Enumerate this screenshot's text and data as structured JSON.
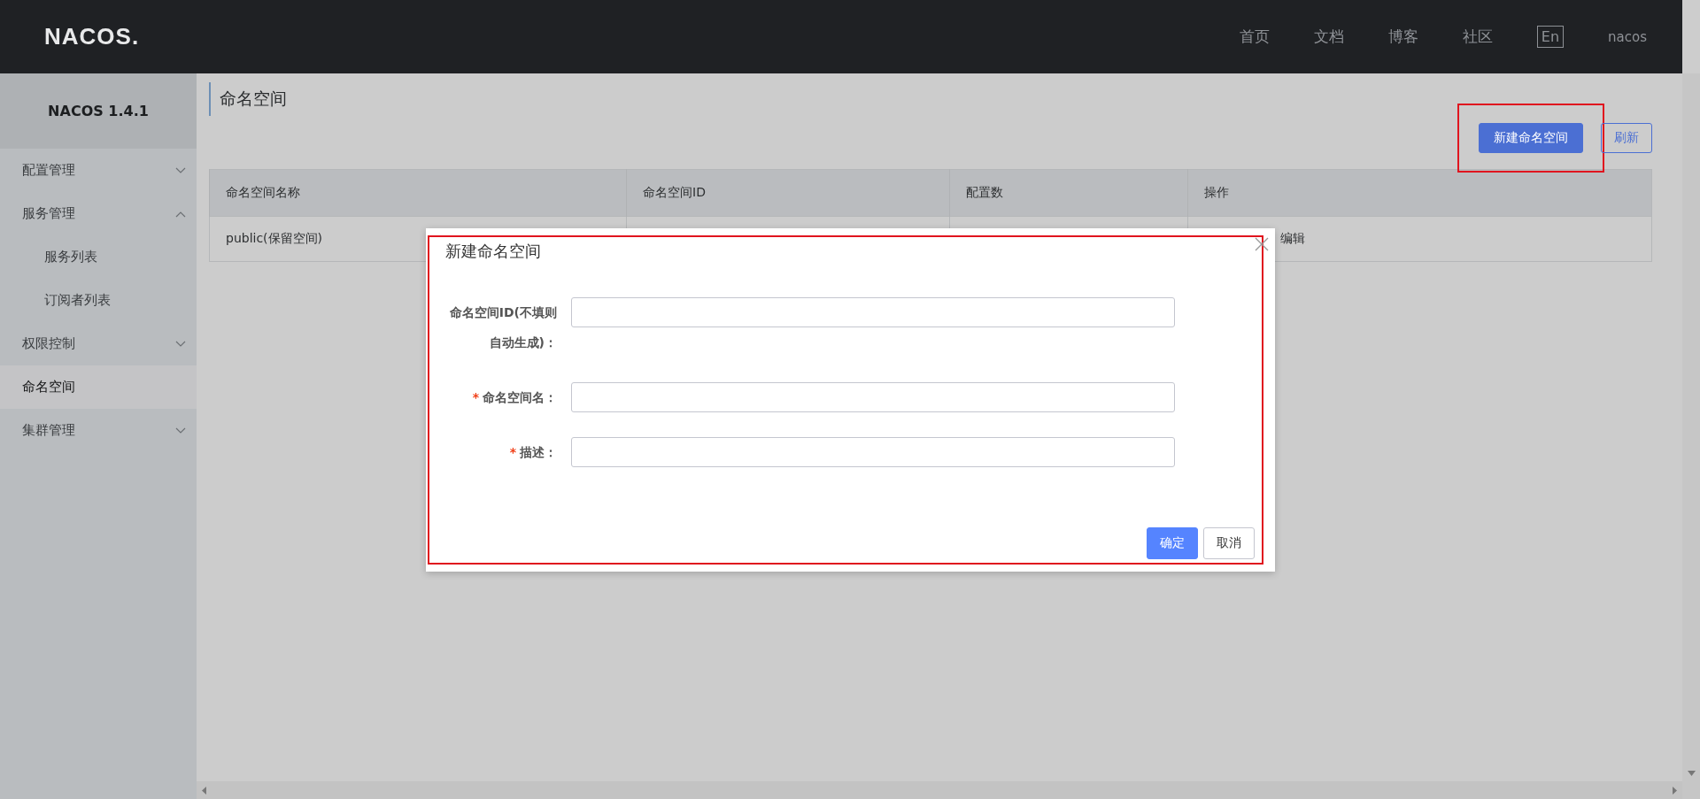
{
  "header": {
    "logo": "NACOS.",
    "nav": [
      {
        "label": "首页"
      },
      {
        "label": "文档"
      },
      {
        "label": "博客"
      },
      {
        "label": "社区"
      }
    ],
    "language_toggle": "En",
    "user": "nacos"
  },
  "sidebar": {
    "title": "NACOS 1.4.1",
    "items": [
      {
        "label": "配置管理",
        "selected": false,
        "expanded": false
      },
      {
        "label": "服务管理",
        "selected": false,
        "expanded": true,
        "children": [
          {
            "label": "服务列表",
            "selected": false
          },
          {
            "label": "订阅者列表",
            "selected": false
          }
        ]
      },
      {
        "label": "权限控制",
        "selected": false,
        "expanded": false
      },
      {
        "label": "命名空间",
        "selected": true
      },
      {
        "label": "集群管理",
        "selected": false,
        "expanded": false
      }
    ]
  },
  "page": {
    "title": "命名空间",
    "buttons": [
      {
        "label": "新建命名空间",
        "kind": "primary",
        "highlighted": true
      },
      {
        "label": "刷新",
        "kind": "outline",
        "highlighted": false
      }
    ]
  },
  "table": {
    "columns": [
      "命名空间名称",
      "命名空间ID",
      "配置数",
      "操作"
    ],
    "rows": [
      {
        "cells": [
          "public(保留空间)",
          "",
          "",
          "编辑"
        ]
      }
    ]
  },
  "dialog": {
    "title": "新建命名空间",
    "highlighted": true,
    "fields": [
      {
        "label": "命名空间ID(不填则自动生成)："
      },
      {
        "label": "命名空间名：",
        "required_mark": "*"
      },
      {
        "label": "描述：",
        "required_mark": "*"
      }
    ],
    "buttons": [
      {
        "label": "确定",
        "kind": "primary"
      },
      {
        "label": "取消",
        "kind": "default"
      }
    ]
  }
}
